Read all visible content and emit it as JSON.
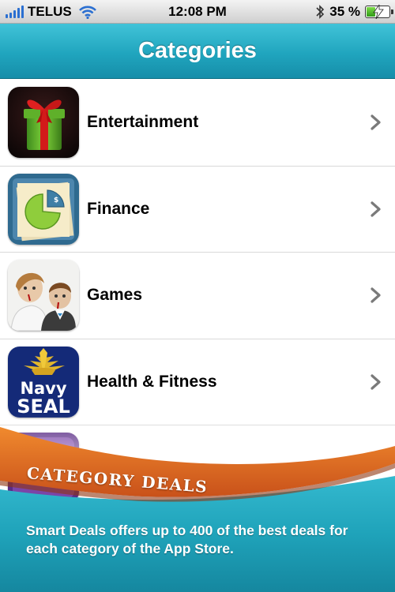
{
  "status_bar": {
    "carrier": "TELUS",
    "time": "12:08 PM",
    "battery_text": "35 %",
    "battery_level": 0.35,
    "icons": [
      "signal-icon",
      "wifi-icon",
      "bluetooth-icon",
      "battery-charging-icon"
    ]
  },
  "nav": {
    "title": "Categories"
  },
  "categories": [
    {
      "label": "Entertainment",
      "icon": "gift-icon"
    },
    {
      "label": "Finance",
      "icon": "pie-chart-icon"
    },
    {
      "label": "Games",
      "icon": "zombie-couple-icon"
    },
    {
      "label": "Health & Fitness",
      "icon": "navy-seal-icon"
    },
    {
      "label": "",
      "icon": "purple-app-icon"
    }
  ],
  "icon_text": {
    "navy_seal_line1": "Navy",
    "navy_seal_line2": "SEAL"
  },
  "deals": {
    "ribbon_title": "CATEGORY DEALS",
    "description": "Smart Deals offers up to 400 of the best deals for each category of the App Store."
  },
  "colors": {
    "nav_teal": "#20a5be",
    "ribbon_orange": "#d9601c",
    "banner_teal": "#1fa3ba"
  }
}
